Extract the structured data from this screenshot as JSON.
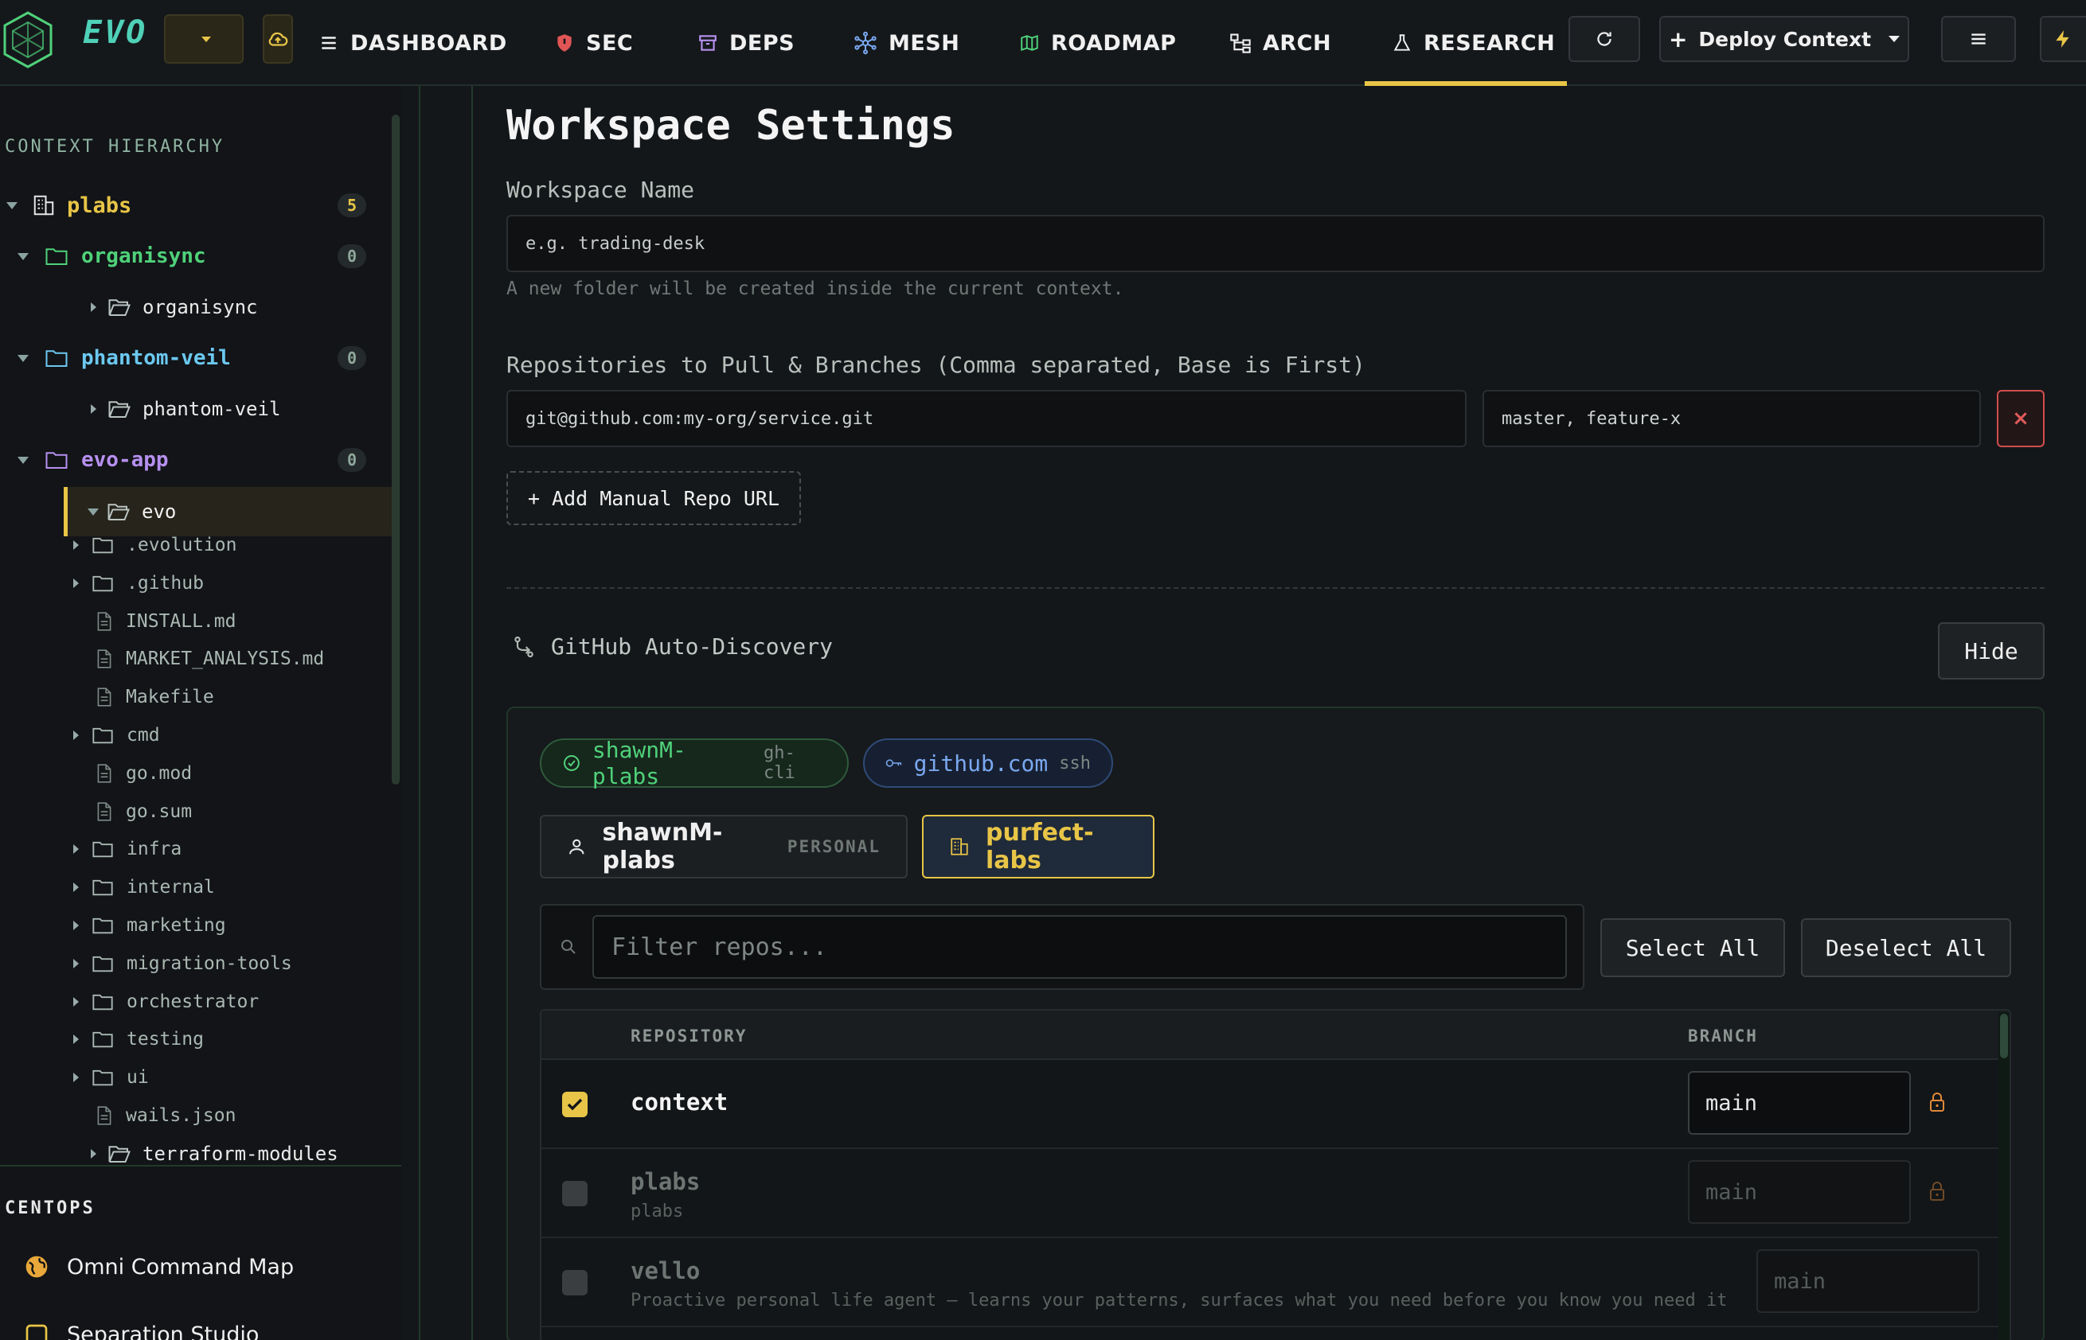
{
  "topbar": {
    "brand": "EVO",
    "nav": [
      {
        "id": "dashboard",
        "label": "DASHBOARD",
        "icon": "list-icon"
      },
      {
        "id": "sec",
        "label": "SEC",
        "icon": "shield-icon"
      },
      {
        "id": "deps",
        "label": "DEPS",
        "icon": "archive-box-icon"
      },
      {
        "id": "mesh",
        "label": "MESH",
        "icon": "network-icon"
      },
      {
        "id": "roadmap",
        "label": "ROADMAP",
        "icon": "map-icon"
      },
      {
        "id": "arch",
        "label": "ARCH",
        "icon": "hierarchy-icon"
      },
      {
        "id": "research",
        "label": "RESEARCH",
        "icon": "flask-icon",
        "active": true
      }
    ],
    "deploy_label": "Deploy Context"
  },
  "sidebar": {
    "heading": "CONTEXT HIERARCHY",
    "root": {
      "label": "plabs",
      "count": "5"
    },
    "groups": [
      {
        "label": "organisync",
        "count": "0",
        "child": "organisync",
        "color": "#4fd17a"
      },
      {
        "label": "phantom-veil",
        "count": "0",
        "child": "phantom-veil",
        "color": "#6cc8f0"
      },
      {
        "label": "evo-app",
        "count": "0",
        "child": "evo",
        "color": "#b690f0"
      }
    ],
    "files": [
      {
        "name": ".evolution",
        "kind": "folder"
      },
      {
        "name": ".github",
        "kind": "folder"
      },
      {
        "name": "INSTALL.md",
        "kind": "file"
      },
      {
        "name": "MARKET_ANALYSIS.md",
        "kind": "file"
      },
      {
        "name": "Makefile",
        "kind": "file"
      },
      {
        "name": "cmd",
        "kind": "folder"
      },
      {
        "name": "go.mod",
        "kind": "file"
      },
      {
        "name": "go.sum",
        "kind": "file"
      },
      {
        "name": "infra",
        "kind": "folder"
      },
      {
        "name": "internal",
        "kind": "folder"
      },
      {
        "name": "marketing",
        "kind": "folder"
      },
      {
        "name": "migration-tools",
        "kind": "folder"
      },
      {
        "name": "orchestrator",
        "kind": "folder"
      },
      {
        "name": "testing",
        "kind": "folder"
      },
      {
        "name": "ui",
        "kind": "folder"
      },
      {
        "name": "wails.json",
        "kind": "file"
      }
    ],
    "partial_item": "terraform-modules",
    "centops_heading": "CENTOPS",
    "centops_items": [
      "Omni Command Map",
      "Separation Studio"
    ]
  },
  "main": {
    "title": "Workspace Settings",
    "workspace_name_label": "Workspace Name",
    "workspace_name_placeholder": "e.g. trading-desk",
    "workspace_helper": "A new folder will be created inside the current context.",
    "repos_label": "Repositories to Pull & Branches (Comma separated, Base is First)",
    "repo_url_placeholder": "git@github.com:my-org/service.git",
    "branches_placeholder": "master, feature-x",
    "remove_label": "×",
    "add_repo_label": "+ Add Manual Repo URL",
    "github": {
      "title": "GitHub Auto-Discovery",
      "hide_label": "Hide",
      "auth_user": "shawnM-plabs",
      "auth_user_method": "gh-cli",
      "auth_host": "github.com",
      "auth_host_method": "ssh",
      "accounts": [
        {
          "name": "shawnM-plabs",
          "tag": "PERSONAL"
        },
        {
          "name": "purfect-labs",
          "tag": "",
          "active": true
        }
      ],
      "filter_placeholder": "Filter repos...",
      "select_all": "Select All",
      "deselect_all": "Deselect All",
      "table": {
        "col_repo": "REPOSITORY",
        "col_branch": "BRANCH",
        "rows": [
          {
            "name": "context",
            "desc": "",
            "branch": "main",
            "checked": true,
            "locked": true
          },
          {
            "name": "plabs",
            "desc": "plabs",
            "branch": "main",
            "checked": false,
            "locked": true
          },
          {
            "name": "vello",
            "desc": "Proactive personal life agent — learns your patterns, surfaces what you need before you know you need it",
            "branch": "main",
            "checked": false,
            "locked": false
          }
        ]
      }
    }
  },
  "colors": {
    "accent": "#e8c547",
    "brand": "#4fd1b8",
    "danger": "#e25b5b"
  }
}
